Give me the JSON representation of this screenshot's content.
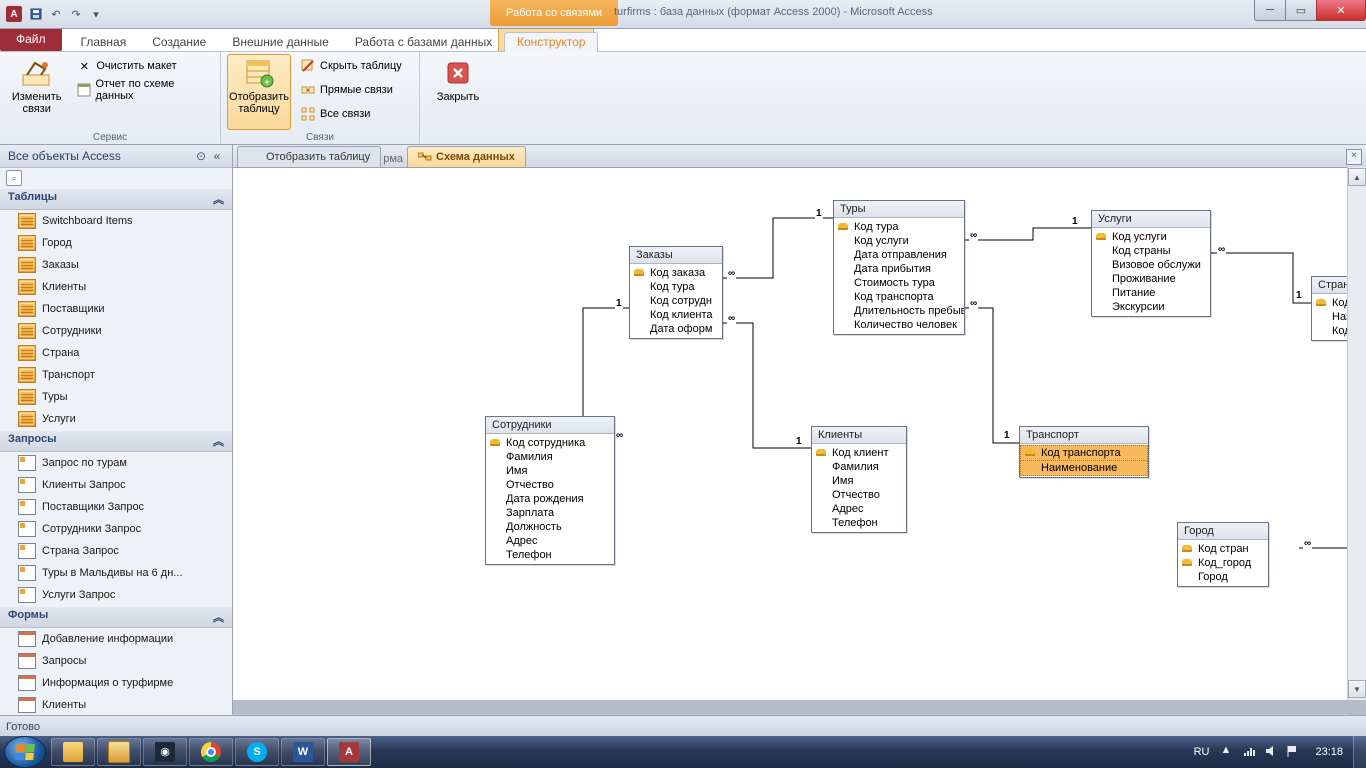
{
  "title": {
    "context_tab": "Работа со связями",
    "document": "turfirms : база данных (формат Access 2000)  -  Microsoft Access",
    "app_letter": "A"
  },
  "ribbon": {
    "file": "Файл",
    "tabs": [
      "Главная",
      "Создание",
      "Внешние данные",
      "Работа с базами данных"
    ],
    "context_tab": "Конструктор",
    "group_service": "Сервис",
    "group_links": "Связи",
    "edit_links": "Изменить связи",
    "clear_layout": "Очистить макет",
    "schema_report": "Отчет по схеме данных",
    "show_table": "Отобразить таблицу",
    "hide_table": "Скрыть таблицу",
    "direct_links": "Прямые связи",
    "all_links": "Все связи",
    "close": "Закрыть"
  },
  "nav": {
    "header": "Все объекты Access",
    "group_tables": "Таблицы",
    "group_queries": "Запросы",
    "group_forms": "Формы",
    "tables": [
      "Switchboard Items",
      "Город",
      "Заказы",
      "Клиенты",
      "Поставщики",
      "Сотрудники",
      "Страна",
      "Транспорт",
      "Туры",
      "Услуги"
    ],
    "queries": [
      "Запрос по турам",
      "Клиенты Запрос",
      "Поставщики Запрос",
      "Сотрудники Запрос",
      "Страна Запрос",
      "Туры в Мальдивы на 6 дн...",
      "Услуги Запрос"
    ],
    "forms": [
      "Добавление информации",
      "Запросы",
      "Информация о турфирме",
      "Клиенты"
    ]
  },
  "doctabs": {
    "tab1": "Отобразить таблицу",
    "tab1_suffix": "рма",
    "tab2": "Схема данных"
  },
  "boxes": {
    "tours": {
      "title": "Туры",
      "fields": [
        "Код тура",
        "Код услуги",
        "Дата отправления",
        "Дата прибытия",
        "Стоимость тура",
        "Код транспорта",
        "Длительность пребыва",
        "Количество человек"
      ]
    },
    "orders": {
      "title": "Заказы",
      "fields": [
        "Код заказа",
        "Код тура",
        "Код сотрудн",
        "Код клиента",
        "Дата оформ"
      ]
    },
    "services": {
      "title": "Услуги",
      "fields": [
        "Код услуги",
        "Код страны",
        "Визовое обслужи",
        "Проживание",
        "Питание",
        "Экскурсии"
      ]
    },
    "country": {
      "title": "Страна",
      "fields": [
        "Код_страны",
        "Название с",
        "Код_город"
      ]
    },
    "employees": {
      "title": "Сотрудники",
      "fields": [
        "Код сотрудника",
        "Фамилия",
        "Имя",
        "Отчество",
        "Дата рождения",
        "Зарплата",
        "Должность",
        "Адрес",
        "Телефон"
      ]
    },
    "clients": {
      "title": "Клиенты",
      "fields": [
        "Код клиент",
        "Фамилия",
        "Имя",
        "Отчество",
        "Адрес",
        "Телефон"
      ]
    },
    "transport": {
      "title": "Транспорт",
      "fields": [
        "Код транспорта",
        "Наименование"
      ]
    },
    "city": {
      "title": "Город",
      "fields": [
        "Код стран",
        "Код_город",
        "Город"
      ]
    }
  },
  "labels": {
    "one": "1",
    "inf": "∞"
  },
  "status": "Готово",
  "tray": {
    "lang": "RU",
    "time": "23:18"
  }
}
